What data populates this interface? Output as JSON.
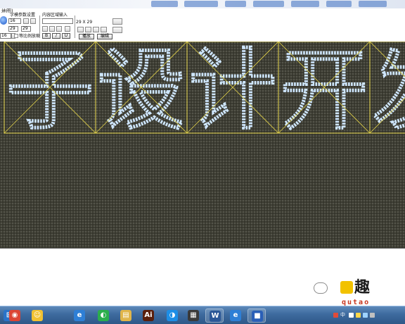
{
  "window": {
    "title": "地图)",
    "toolbar": {
      "section_a": "字模参数设置",
      "section_b": "内容区域输入",
      "label_font_size": "16",
      "label_width": "29",
      "label_height": "29",
      "spacing_label": "等比例放缩",
      "coord_value": "29 X 29",
      "play_label": "播放",
      "edit_label": "编辑",
      "apply_label": "应用",
      "selected_option": "16"
    }
  },
  "led": {
    "glyphs": [
      "子",
      "设",
      "计",
      "开",
      "发"
    ],
    "colors": {
      "background": "#2f2f26",
      "dot_off": "#4e4e42",
      "dot_on": "#cfe7ff",
      "guide": "#e3d34a"
    }
  },
  "watermark": {
    "text": "趣",
    "domain": "qutao"
  },
  "taskbar": {
    "apps": [
      {
        "name": "start",
        "glyph": "⊞",
        "color": "#2a73c9"
      },
      {
        "name": "chrome",
        "glyph": "◉",
        "color": "#dc4434"
      },
      {
        "name": "messenger",
        "glyph": "☺",
        "color": "#f1c232"
      },
      {
        "name": "ie",
        "glyph": "e",
        "color": "#2e7fd6"
      },
      {
        "name": "wechat-pc",
        "glyph": "◐",
        "color": "#2bae4d"
      },
      {
        "name": "folder",
        "glyph": "▤",
        "color": "#e0b54a"
      },
      {
        "name": "illustrator",
        "glyph": "Ai",
        "color": "#5a1f0d"
      },
      {
        "name": "media",
        "glyph": "◑",
        "color": "#1d8ee6"
      },
      {
        "name": "monitor",
        "glyph": "▦",
        "color": "#3a3a3a"
      },
      {
        "name": "word",
        "glyph": "W",
        "color": "#2b5797"
      },
      {
        "name": "ie2",
        "glyph": "e",
        "color": "#2e7fd6"
      },
      {
        "name": "led-editor",
        "glyph": "■",
        "color": "#2a5fb7"
      }
    ],
    "tray_lang": "中"
  }
}
